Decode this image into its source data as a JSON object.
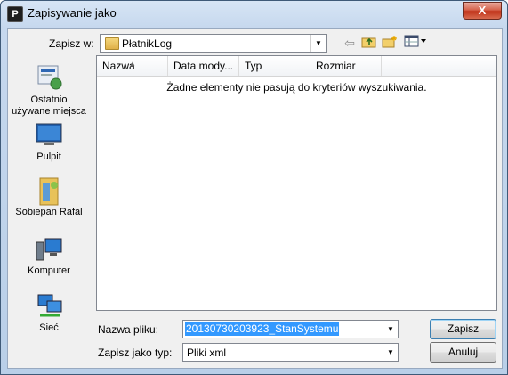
{
  "window": {
    "title": "Zapisywanie jako",
    "close_glyph": "X",
    "icon_letter": "P"
  },
  "save_in": {
    "label": "Zapisz w:",
    "value": "PłatnikLog"
  },
  "toolbar": {
    "back_icon": "back-arrow-icon",
    "up_icon": "folder-up-icon",
    "new_folder_icon": "new-folder-icon",
    "views_icon": "views-menu-icon"
  },
  "places": [
    {
      "id": "recent",
      "label": "Ostatnio\nużywane miejsca"
    },
    {
      "id": "desktop",
      "label": "Pulpit"
    },
    {
      "id": "user",
      "label": "Sobiepan Rafal"
    },
    {
      "id": "computer",
      "label": "Komputer"
    },
    {
      "id": "network",
      "label": "Sieć"
    }
  ],
  "columns": [
    "Nazwa",
    "Data mody...",
    "Typ",
    "Rozmiar"
  ],
  "empty_message": "Żadne elementy nie pasują do kryteriów wyszukiwania.",
  "filename": {
    "label": "Nazwa pliku:",
    "value": "20130730203923_StanSystemu"
  },
  "filetype": {
    "label": "Zapisz jako typ:",
    "value": "Pliki xml"
  },
  "buttons": {
    "save": "Zapisz",
    "cancel": "Anuluj"
  },
  "colors": {
    "selection": "#3399ff",
    "close_button": "#c0331a"
  }
}
